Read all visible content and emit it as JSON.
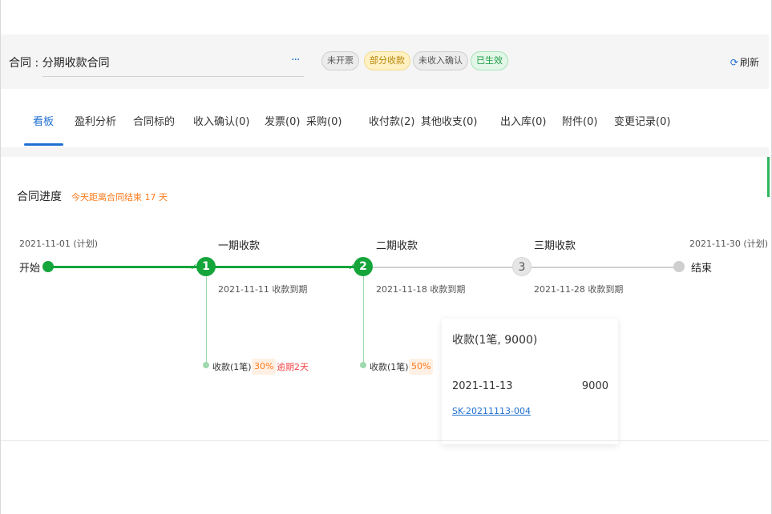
{
  "header": {
    "contract_label": "合同 : 分期收款合同",
    "more": "···",
    "tags": [
      {
        "label": "未开票",
        "style": "gray"
      },
      {
        "label": "部分收款",
        "style": "yellow"
      },
      {
        "label": "未收入确认",
        "style": "gray"
      },
      {
        "label": "已生效",
        "style": "green"
      }
    ],
    "refresh_icon": "refresh-icon",
    "refresh_label": "刷新"
  },
  "tabs": [
    {
      "label": "看板",
      "active": true
    },
    {
      "label": "盈利分析"
    },
    {
      "label": "合同标的"
    },
    {
      "label": "收入确认(0)"
    },
    {
      "label": "发票(0)"
    },
    {
      "label": "采购(0)"
    },
    {
      "label": "收付款(2)"
    },
    {
      "label": "其他收支(0)"
    },
    {
      "label": "出入库(0)"
    },
    {
      "label": "附件(0)"
    },
    {
      "label": "变更记录(0)"
    }
  ],
  "progress": {
    "title": "合同进度",
    "hint": "今天距离合同结束 17 天",
    "start": {
      "date": "2021-11-01 (计划)",
      "label": "开始"
    },
    "end": {
      "date": "2021-11-30 (计划)",
      "label": "结束"
    },
    "stages": [
      {
        "num": "1",
        "title": "一期收款",
        "due": "2021-11-11 收款到期",
        "status": "done",
        "receipt": "收款(1笔)",
        "percent": "30%",
        "overdue": "逾期2天"
      },
      {
        "num": "2",
        "title": "二期收款",
        "due": "2021-11-18 收款到期",
        "status": "done",
        "receipt": "收款(1笔)",
        "percent": "50%",
        "overdue": ""
      },
      {
        "num": "3",
        "title": "三期收款",
        "due": "2021-11-28 收款到期",
        "status": "todo"
      }
    ],
    "check_icon": "check-icon"
  },
  "popover": {
    "title": "收款(1笔, 9000)",
    "date": "2021-11-13",
    "amount": "9000",
    "link": "SK-20211113-004"
  },
  "colors": {
    "accent": "#1f6fd1",
    "success": "#15a53a",
    "warning": "#ff7a1a",
    "danger": "#f04848"
  }
}
